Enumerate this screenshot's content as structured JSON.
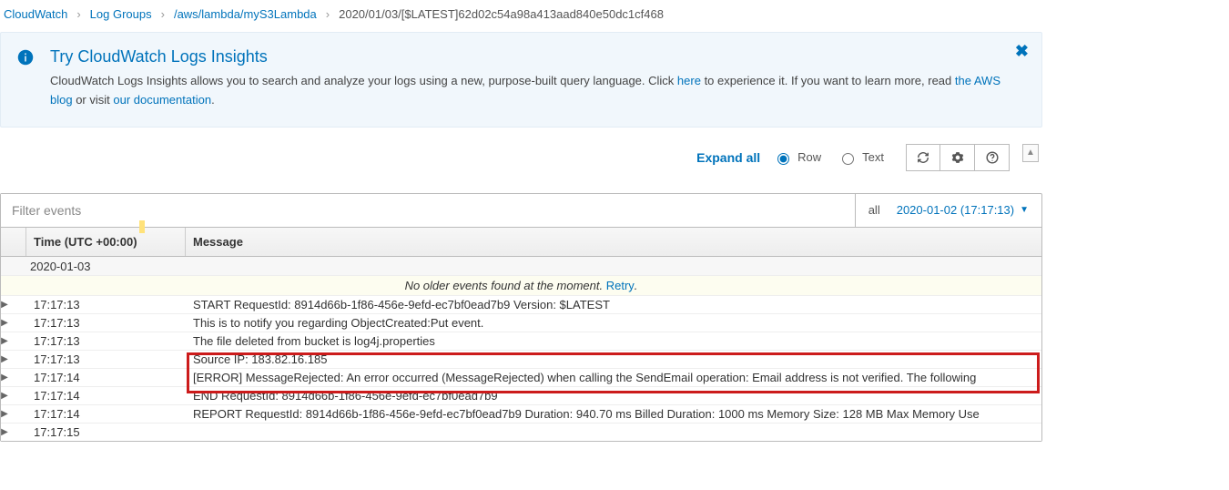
{
  "breadcrumb": {
    "items": [
      "CloudWatch",
      "Log Groups",
      "/aws/lambda/myS3Lambda",
      "2020/01/03/[$LATEST]62d02c54a98a413aad840e50dc1cf468"
    ]
  },
  "info": {
    "title": "Try CloudWatch Logs Insights",
    "desc_1": "CloudWatch Logs Insights allows you to search and analyze your logs using a new, purpose-built query language. Click ",
    "link_here": "here",
    "desc_2": " to experience it. If you want to learn more, read ",
    "link_blog": "the AWS blog",
    "desc_3": " or visit ",
    "link_docs": "our documentation",
    "desc_4": "."
  },
  "toolbar": {
    "expand_all": "Expand all",
    "row_label": "Row",
    "text_label": "Text"
  },
  "filter": {
    "placeholder": "Filter events",
    "all_label": "all",
    "date_label": "2020-01-02 (17:17:13)"
  },
  "headers": {
    "time": "Time (UTC +00:00)",
    "message": "Message"
  },
  "date_group": "2020-01-03",
  "no_older": {
    "text": "No older events found at the moment. ",
    "retry": "Retry"
  },
  "rows": [
    {
      "time": "17:17:13",
      "msg": "START RequestId: 8914d66b-1f86-456e-9efd-ec7bf0ead7b9 Version: $LATEST"
    },
    {
      "time": "17:17:13",
      "msg": "This is to notify you regarding ObjectCreated:Put event."
    },
    {
      "time": "17:17:13",
      "msg": "The file deleted from bucket is log4j.properties"
    },
    {
      "time": "17:17:13",
      "msg": "Source IP: 183.82.16.185"
    },
    {
      "time": "17:17:14",
      "msg": "[ERROR] MessageRejected: An error occurred (MessageRejected) when calling the SendEmail operation: Email address is not verified. The following"
    },
    {
      "time": "17:17:14",
      "msg": "END RequestId: 8914d66b-1f86-456e-9efd-ec7bf0ead7b9"
    },
    {
      "time": "17:17:14",
      "msg": "REPORT RequestId: 8914d66b-1f86-456e-9efd-ec7bf0ead7b9 Duration: 940.70 ms Billed Duration: 1000 ms Memory Size: 128 MB Max Memory Use"
    },
    {
      "time": "17:17:15",
      "msg": ""
    }
  ]
}
